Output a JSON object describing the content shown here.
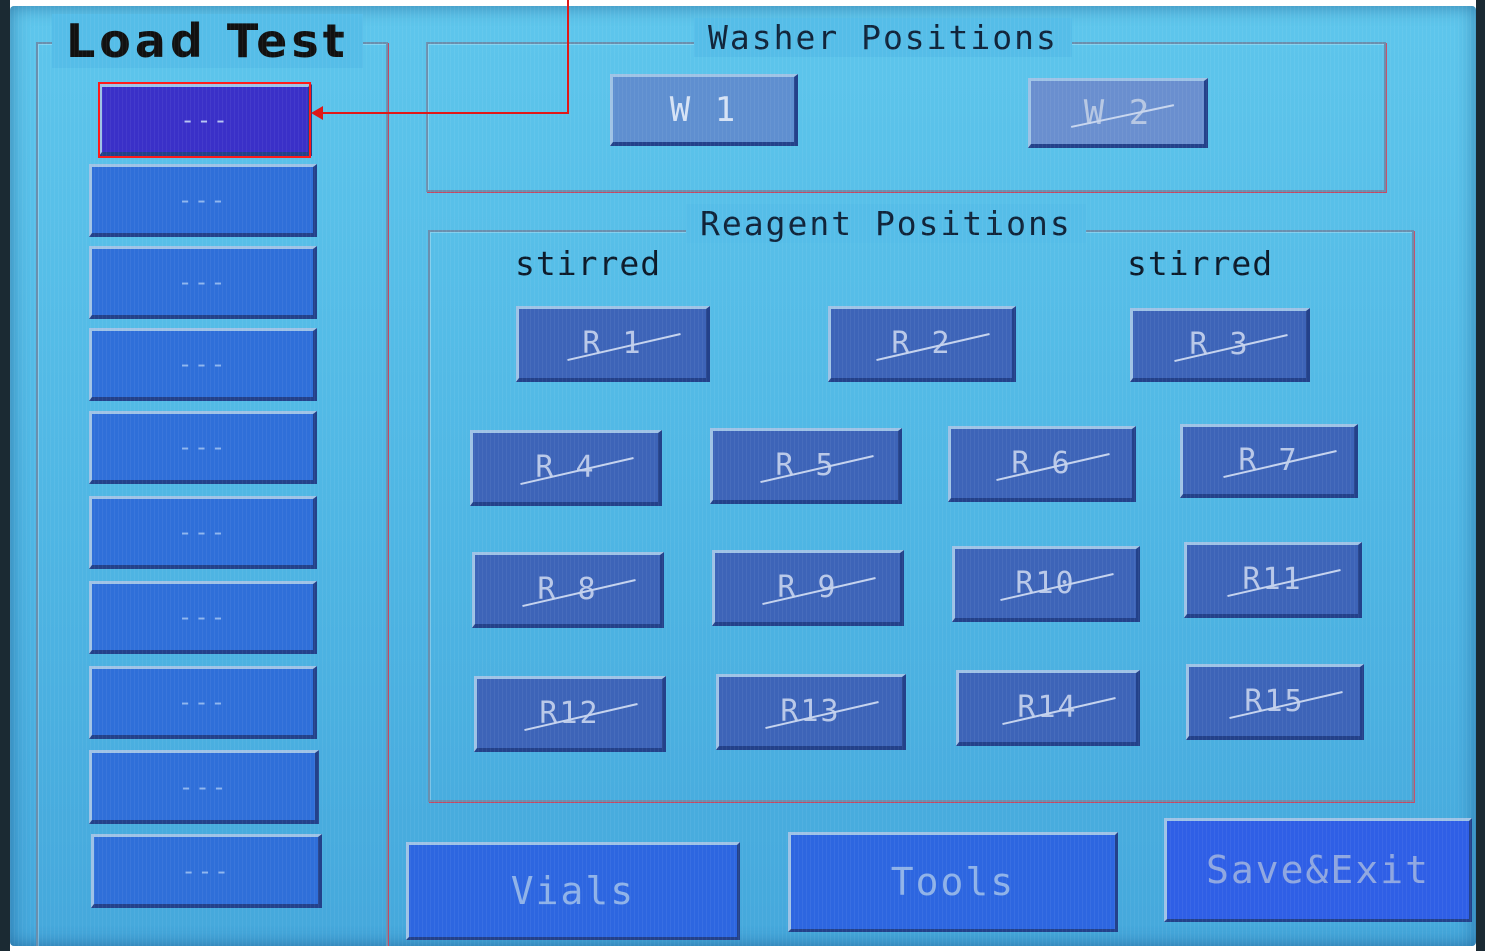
{
  "load_test": {
    "title": "Load Test",
    "slots": [
      {
        "label": "---",
        "state": "selected"
      },
      {
        "label": "---",
        "state": "normal"
      },
      {
        "label": "---",
        "state": "normal"
      },
      {
        "label": "---",
        "state": "normal"
      },
      {
        "label": "---",
        "state": "normal"
      },
      {
        "label": "---",
        "state": "normal"
      },
      {
        "label": "---",
        "state": "normal"
      },
      {
        "label": "---",
        "state": "normal"
      },
      {
        "label": "---",
        "state": "normal"
      },
      {
        "label": "---",
        "state": "normal"
      }
    ]
  },
  "washer": {
    "title": "Washer Positions",
    "positions": [
      {
        "label": "W 1",
        "state": "enabled"
      },
      {
        "label": "W 2",
        "state": "disabled"
      }
    ]
  },
  "reagent": {
    "title": "Reagent Positions",
    "stirred_label_left": "stirred",
    "stirred_label_right": "stirred",
    "positions": [
      {
        "label": "R 1",
        "state": "disabled"
      },
      {
        "label": "R 2",
        "state": "disabled"
      },
      {
        "label": "R 3",
        "state": "disabled"
      },
      {
        "label": "R 4",
        "state": "disabled"
      },
      {
        "label": "R 5",
        "state": "disabled"
      },
      {
        "label": "R 6",
        "state": "disabled"
      },
      {
        "label": "R 7",
        "state": "disabled"
      },
      {
        "label": "R 8",
        "state": "disabled"
      },
      {
        "label": "R 9",
        "state": "disabled"
      },
      {
        "label": "R10",
        "state": "disabled"
      },
      {
        "label": "R11",
        "state": "disabled"
      },
      {
        "label": "R12",
        "state": "disabled"
      },
      {
        "label": "R13",
        "state": "disabled"
      },
      {
        "label": "R14",
        "state": "disabled"
      },
      {
        "label": "R15",
        "state": "disabled"
      }
    ]
  },
  "bottom_bar": {
    "vials_label": "Vials",
    "tools_label": "Tools",
    "save_exit_label": "Save&Exit"
  },
  "colors": {
    "screen_bg": "#55bde8",
    "slot_selected": "#3a30c8",
    "slot_normal": "#2f6fd9",
    "reagent_button": "#3d64b8",
    "annotation": "#e01818"
  }
}
